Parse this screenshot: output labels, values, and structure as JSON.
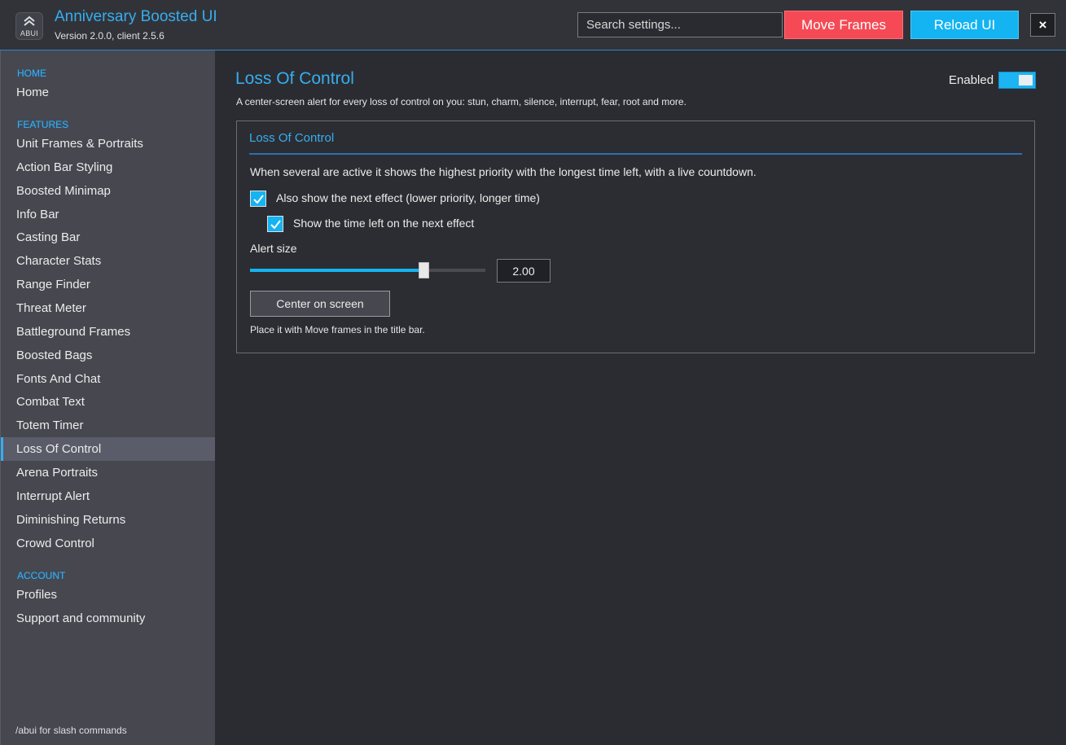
{
  "header": {
    "logo_text": "ABUI",
    "title": "Anniversary Boosted UI",
    "version": "Version 2.0.0, client 2.5.6",
    "search_placeholder": "Search settings...",
    "move_frames_label": "Move Frames",
    "reload_ui_label": "Reload UI",
    "close_label": "×"
  },
  "sidebar": {
    "sections": [
      {
        "label": "HOME",
        "items": [
          "Home"
        ]
      },
      {
        "label": "FEATURES",
        "items": [
          "Unit Frames & Portraits",
          "Action Bar Styling",
          "Boosted Minimap",
          "Info Bar",
          "Casting Bar",
          "Character Stats",
          "Range Finder",
          "Threat Meter",
          "Battleground Frames",
          "Boosted Bags",
          "Fonts And Chat",
          "Combat Text",
          "Totem Timer",
          "Loss Of Control",
          "Arena Portraits",
          "Interrupt Alert",
          "Diminishing Returns",
          "Crowd Control"
        ]
      },
      {
        "label": "ACCOUNT",
        "items": [
          "Profiles",
          "Support and community"
        ]
      }
    ],
    "active_item": "Loss Of Control",
    "footer": "/abui for slash commands"
  },
  "main": {
    "title": "Loss Of Control",
    "description": "A center-screen alert for every loss of control on you: stun, charm, silence, interrupt, fear, root and more.",
    "enabled_label": "Enabled",
    "enabled": true,
    "panel": {
      "title": "Loss Of Control",
      "description": "When several are active it shows the highest priority with the longest time left, with a live countdown.",
      "checkbox_next_effect": {
        "label": "Also show the next effect (lower priority, longer time)",
        "checked": true
      },
      "checkbox_time_left": {
        "label": "Show the time left on the next effect",
        "checked": true
      },
      "alert_size_label": "Alert size",
      "alert_size_fraction": 0.74,
      "alert_size_value": "2.00",
      "center_button_label": "Center on screen",
      "hint": "Place it with Move frames in the title bar."
    }
  },
  "colors": {
    "accent": "#35aef0",
    "move_frames": "#f54a55",
    "reload_ui": "#14b3f2"
  },
  "icons": {
    "logo": "chevron-up-icon",
    "checkbox": "check-icon",
    "close": "close-icon"
  }
}
